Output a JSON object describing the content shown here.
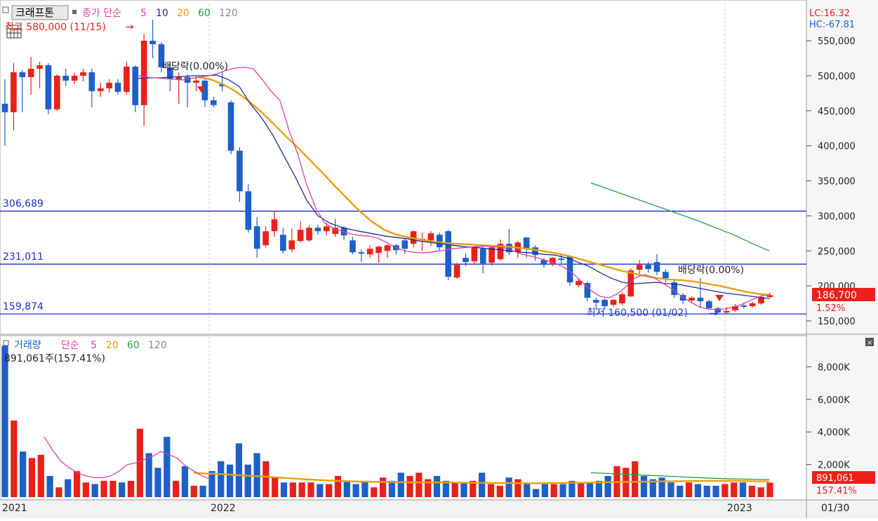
{
  "price_panel": {
    "chart_name": "크래프톤",
    "ma_label": "종가 단순",
    "ma_periods": [
      "5",
      "10",
      "20",
      "60",
      "120"
    ],
    "high_label": "최고 580,000 (11/15)",
    "low_label": "최저 160,500 (01/02)",
    "dividend_labels": [
      "배당락(0.00%)",
      "배당락(0.00%)"
    ],
    "lc_label": "LC:16.32",
    "hc_label": "HC:-67.81",
    "current_price": "186,700",
    "change_pct": "1.52%"
  },
  "volume_panel": {
    "title": "거래량",
    "ma_label": "단순",
    "ma_periods": [
      "5",
      "20",
      "60",
      "120"
    ],
    "info_label": "891,061주(157.41%)",
    "current_volume": "891,061",
    "change_pct": "157.41%"
  },
  "colors": {
    "up": "#e8211a",
    "down": "#1e5fc8",
    "ma5": "#e040a0",
    "ma10": "#1a2e8c",
    "ma20": "#e8a010",
    "ma60": "#20a040",
    "hline": "#1a2ec8",
    "price_box_bg": "#e8211a"
  },
  "time_axis": {
    "labels": [
      "2021",
      "2022",
      "2023",
      "01/30"
    ]
  },
  "chart_data": [
    {
      "type": "candlestick",
      "title": "크래프톤",
      "y_axis": {
        "range": [
          130000,
          620000
        ],
        "ticks": [
          150000,
          200000,
          250000,
          300000,
          350000,
          400000,
          450000,
          500000,
          550000
        ],
        "tick_labels": [
          "150,000",
          "200,000",
          "250,000",
          "300,000",
          "350,000",
          "400,000",
          "450,000",
          "500,000",
          "550,000"
        ]
      },
      "horizontal_lines": [
        {
          "value": 306689,
          "label": "306,689"
        },
        {
          "value": 231011,
          "label": "231,011"
        },
        {
          "value": 159874,
          "label": "159,874"
        }
      ],
      "candles": [
        [
          460000,
          448000,
          495000,
          400000
        ],
        [
          448000,
          505000,
          518000,
          422000
        ],
        [
          505000,
          498000,
          508000,
          448000
        ],
        [
          498000,
          510000,
          527000,
          473000
        ],
        [
          510000,
          515000,
          520000,
          482000
        ],
        [
          515000,
          452000,
          518000,
          445000
        ],
        [
          452000,
          500000,
          502000,
          450000
        ],
        [
          500000,
          493000,
          510000,
          485000
        ],
        [
          493000,
          500000,
          504000,
          488000
        ],
        [
          500000,
          505000,
          510000,
          492000
        ],
        [
          505000,
          478000,
          510000,
          455000
        ],
        [
          478000,
          482000,
          490000,
          470000
        ],
        [
          482000,
          490000,
          495000,
          476000
        ],
        [
          490000,
          477000,
          495000,
          473000
        ],
        [
          477000,
          513000,
          520000,
          473000
        ],
        [
          513000,
          458000,
          515000,
          448000
        ],
        [
          458000,
          550000,
          560000,
          428000
        ],
        [
          550000,
          545000,
          580000,
          525000
        ],
        [
          545000,
          512000,
          548000,
          505000
        ],
        [
          512000,
          495000,
          520000,
          478000
        ],
        [
          495000,
          498000,
          505000,
          460000
        ],
        [
          498000,
          490000,
          502000,
          455000
        ],
        [
          490000,
          493000,
          500000,
          478000
        ],
        [
          493000,
          465000,
          495000,
          455000
        ],
        [
          465000,
          458000,
          470000,
          455000
        ],
        [
          488000,
          485000,
          505000,
          478000
        ],
        [
          462000,
          393000,
          465000,
          388000
        ],
        [
          393000,
          335000,
          398000,
          320000
        ],
        [
          335000,
          280000,
          345000,
          276000
        ],
        [
          285000,
          253000,
          298000,
          240000
        ],
        [
          258000,
          278000,
          285000,
          255000
        ],
        [
          278000,
          295000,
          307000,
          270000
        ],
        [
          273000,
          250000,
          283000,
          246000
        ],
        [
          252000,
          265000,
          282000,
          248000
        ],
        [
          264000,
          280000,
          292000,
          262000
        ],
        [
          265000,
          283000,
          287000,
          263000
        ],
        [
          283000,
          278000,
          287000,
          273000
        ],
        [
          278000,
          285000,
          290000,
          272000
        ],
        [
          274000,
          283000,
          296000,
          270000
        ],
        [
          283000,
          272000,
          285000,
          265000
        ],
        [
          265000,
          248000,
          270000,
          245000
        ],
        [
          248000,
          246000,
          252000,
          234000
        ],
        [
          245000,
          253000,
          258000,
          240000
        ],
        [
          247000,
          256000,
          257000,
          233000
        ],
        [
          250000,
          258000,
          259000,
          240000
        ],
        [
          258000,
          251000,
          260000,
          245000
        ],
        [
          265000,
          253000,
          268000,
          246000
        ],
        [
          260000,
          278000,
          279000,
          255000
        ],
        [
          265000,
          267000,
          276000,
          250000
        ],
        [
          265000,
          275000,
          278000,
          257000
        ],
        [
          273000,
          255000,
          276000,
          250000
        ],
        [
          278000,
          213000,
          280000,
          208000
        ],
        [
          212000,
          230000,
          233000,
          210000
        ],
        [
          240000,
          234000,
          246000,
          228000
        ],
        [
          235000,
          256000,
          257000,
          230000
        ],
        [
          253000,
          232000,
          257000,
          218000
        ],
        [
          233000,
          255000,
          256000,
          229000
        ],
        [
          238000,
          260000,
          266000,
          236000
        ],
        [
          260000,
          248000,
          281000,
          244000
        ],
        [
          248000,
          262000,
          264000,
          240000
        ],
        [
          269000,
          253000,
          270000,
          240000
        ],
        [
          255000,
          244000,
          258000,
          236000
        ],
        [
          237000,
          230000,
          240000,
          226000
        ],
        [
          232000,
          240000,
          241000,
          228000
        ],
        [
          239000,
          237000,
          244000,
          231000
        ],
        [
          242000,
          205000,
          243000,
          200000
        ],
        [
          201000,
          207000,
          210000,
          198000
        ],
        [
          204000,
          183000,
          206000,
          178000
        ],
        [
          180000,
          176000,
          183000,
          166000
        ],
        [
          180000,
          171000,
          182000,
          165000
        ],
        [
          173000,
          180000,
          181000,
          170000
        ],
        [
          175000,
          188000,
          191000,
          172000
        ],
        [
          185000,
          222000,
          225000,
          184000
        ],
        [
          223000,
          230000,
          237000,
          215000
        ],
        [
          230000,
          224000,
          234000,
          219000
        ],
        [
          234000,
          220000,
          245000,
          215000
        ],
        [
          220000,
          211000,
          224000,
          205000
        ],
        [
          205000,
          187000,
          210000,
          183000
        ],
        [
          187000,
          179000,
          190000,
          174000
        ],
        [
          179000,
          183000,
          185000,
          176000
        ],
        [
          183000,
          178000,
          211000,
          168000
        ],
        [
          178000,
          168000,
          180000,
          166000
        ],
        [
          168000,
          162000,
          170000,
          160500
        ],
        [
          162000,
          164000,
          170000,
          160500
        ],
        [
          165000,
          171000,
          174000,
          163000
        ],
        [
          172000,
          170000,
          176000,
          167000
        ],
        [
          171000,
          175000,
          177000,
          169000
        ],
        [
          175000,
          184000,
          187000,
          173000
        ],
        [
          184000,
          186700,
          190000,
          182000
        ]
      ],
      "ma5": [
        500000,
        498000,
        497000,
        496000,
        495000,
        494000,
        496000,
        498000,
        500000,
        503000,
        508000,
        511000,
        512000,
        510000,
        495000,
        478000,
        465000,
        423000,
        388000,
        345000,
        312000,
        290000,
        282000,
        278000,
        274000,
        272000,
        271000,
        268000,
        262000,
        255000,
        250000,
        248000,
        247000,
        248000,
        250000,
        252000,
        254000,
        255000,
        256000,
        257000,
        256000,
        255000,
        251000,
        246000,
        243000,
        240000,
        236000,
        232000,
        226000,
        217000,
        205000,
        193000,
        185000,
        183000,
        189000,
        200000,
        212000,
        216000,
        212000,
        204000,
        196000,
        187000,
        178000,
        171000,
        167000,
        166000,
        167000,
        170000,
        174000,
        180000,
        185000,
        188000
      ],
      "ma10": [
        496000,
        497000,
        497000,
        498000,
        499000,
        500000,
        500000,
        501000,
        495000,
        485000,
        460000,
        440000,
        415000,
        385000,
        355000,
        322000,
        300000,
        290000,
        284000,
        280000,
        277000,
        274000,
        271000,
        269000,
        267000,
        264000,
        262000,
        260000,
        258000,
        256000,
        255000,
        253000,
        252000,
        250000,
        248000,
        247000,
        245000,
        244000,
        240000,
        234000,
        228000,
        219000,
        211000,
        205000,
        203000,
        204000,
        205000,
        203000,
        202000,
        199000,
        196000,
        193000,
        190000,
        188000,
        186000,
        184000,
        182000
      ],
      "ma20": [
        498000,
        495000,
        488000,
        478000,
        465000,
        450000,
        433000,
        415000,
        398000,
        380000,
        362000,
        343000,
        325000,
        307000,
        292000,
        280000,
        273000,
        269000,
        266000,
        263000,
        261000,
        260000,
        259000,
        258000,
        257000,
        256000,
        254000,
        252000,
        249000,
        246000,
        242000,
        237000,
        232000,
        227000,
        222000,
        218000,
        214000,
        211000,
        209000,
        208000,
        206000,
        203000,
        200000,
        196000,
        192000,
        189000,
        187000
      ],
      "ma60": [
        347000,
        338000,
        329000,
        320000,
        311000,
        302000,
        293000,
        283000,
        273000,
        261000,
        250000
      ]
    },
    {
      "type": "bar",
      "title": "거래량",
      "y_axis": {
        "range": [
          0,
          10000000
        ],
        "ticks": [
          2000000,
          4000000,
          6000000,
          8000000
        ],
        "tick_labels": [
          "2,000K",
          "4,000K",
          "6,000K",
          "8,000K"
        ]
      },
      "values": [
        9300000,
        4700000,
        2800000,
        2400000,
        2600000,
        1300000,
        600000,
        1100000,
        1600000,
        900000,
        800000,
        1000000,
        1000000,
        900000,
        1000000,
        4200000,
        2700000,
        1800000,
        3700000,
        1000000,
        1900000,
        700000,
        700000,
        1600000,
        2200000,
        2000000,
        3300000,
        2000000,
        2700000,
        2200000,
        1200000,
        900000,
        900000,
        900000,
        900000,
        800000,
        800000,
        1300000,
        1000000,
        800000,
        1000000,
        600000,
        1200000,
        1000000,
        1500000,
        1300000,
        1500000,
        1100000,
        1300000,
        1000000,
        900000,
        900000,
        1000000,
        1500000,
        800000,
        700000,
        1200000,
        1100000,
        900000,
        500000,
        800000,
        800000,
        800000,
        1000000,
        900000,
        900000,
        1000000,
        1300000,
        1900000,
        1800000,
        2200000,
        1300000,
        1100000,
        1200000,
        900000,
        700000,
        900000,
        800000,
        700000,
        700000,
        800000,
        900000,
        900000,
        700000,
        600000,
        891061
      ],
      "ma5": [
        3700000,
        2900000,
        2200000,
        1800000,
        1500000,
        1300000,
        1200000,
        1200000,
        1300000,
        1600000,
        2000000,
        2100000,
        2300000,
        2500000,
        2800000,
        2600000,
        2400000,
        1900000,
        1600000,
        1300000,
        1100000
      ],
      "ma20": [
        1500000,
        1450000,
        1420000,
        1380000,
        1330000,
        1290000,
        1250000,
        1200000,
        1150000,
        1100000,
        1060000,
        1020000,
        990000,
        970000,
        950000,
        940000,
        930000,
        920000,
        910000,
        900000,
        900000,
        900000,
        890000,
        880000,
        870000,
        860000,
        860000,
        850000,
        850000,
        860000,
        870000,
        880000,
        890000,
        900000,
        920000,
        930000,
        940000,
        950000,
        960000,
        970000,
        980000,
        990000,
        1000000,
        1000000,
        1000000,
        990000,
        980000,
        970000
      ],
      "ma60": [
        1500000,
        1450000,
        1400000,
        1350000,
        1300000,
        1250000,
        1200000,
        1150000,
        1120000,
        1100000,
        1080000
      ]
    }
  ]
}
